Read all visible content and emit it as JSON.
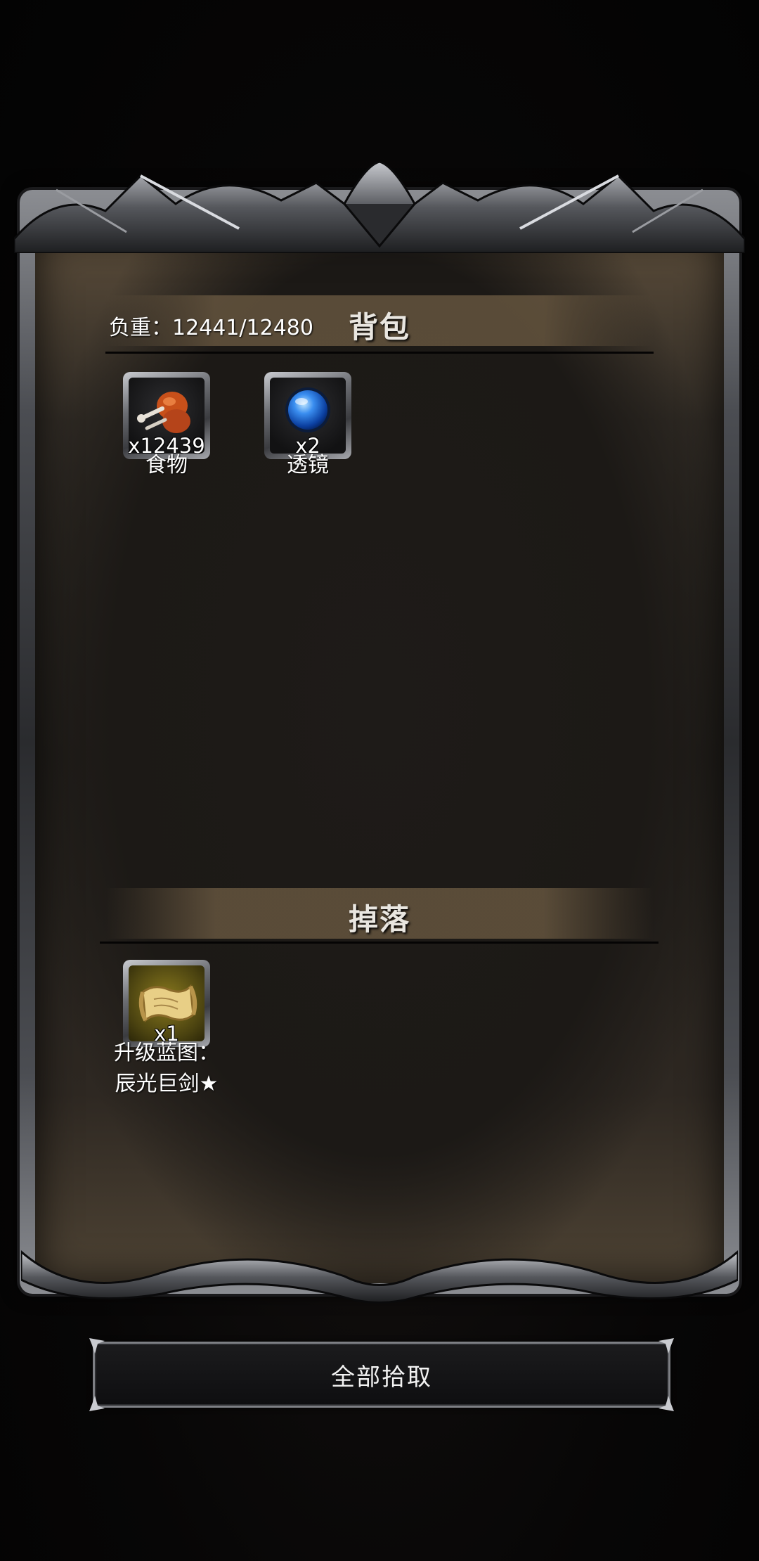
{
  "backpack": {
    "weight_label": "负重：12441/12480",
    "title": "背包",
    "items": [
      {
        "name": "食物",
        "count": "x12439",
        "icon": "drumstick-icon"
      },
      {
        "name": "透镜",
        "count": "x2",
        "icon": "blue-orb-lens-icon"
      }
    ]
  },
  "drops": {
    "title": "掉落",
    "items": [
      {
        "name_line1": "升级蓝图：",
        "name_line2": "辰光巨剑★",
        "count": "x1",
        "icon": "blueprint-scroll-icon"
      }
    ]
  },
  "actions": {
    "pickup_all_label": "全部拾取"
  },
  "colors": {
    "panel_bg": "#1f1c19",
    "header_band": "#645440",
    "frame_metal": "#6c6e73",
    "drop_slot_gold": "#8a7a1e"
  }
}
